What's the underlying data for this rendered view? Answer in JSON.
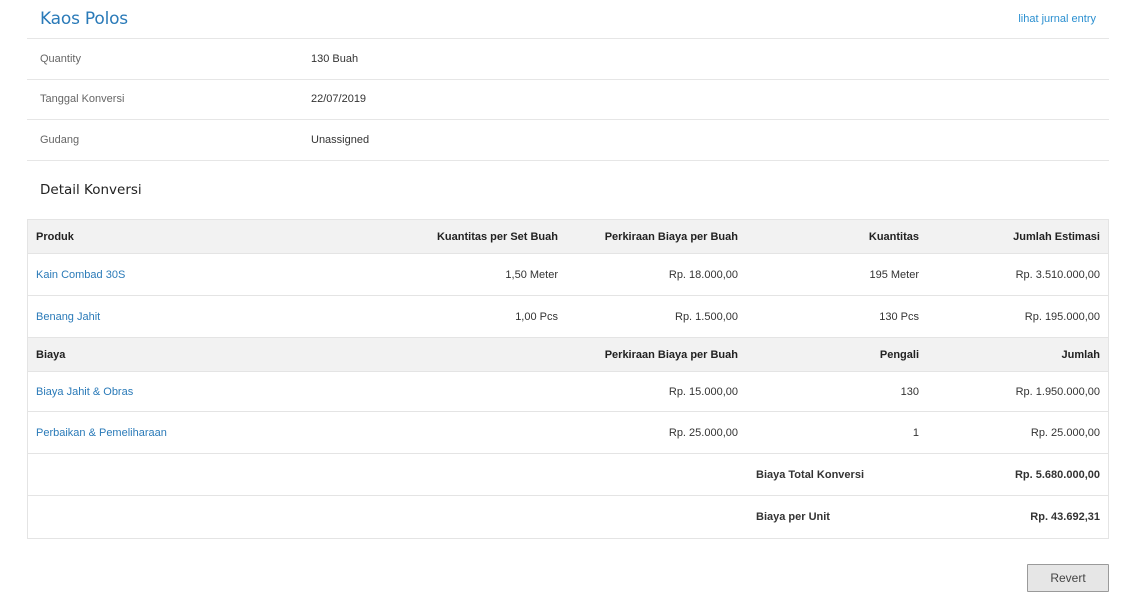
{
  "header": {
    "title": "Kaos Polos",
    "journal_link": "lihat jurnal entry"
  },
  "info": [
    {
      "label": "Quantity",
      "value": "130 Buah"
    },
    {
      "label": "Tanggal Konversi",
      "value": "22/07/2019"
    },
    {
      "label": "Gudang",
      "value": "Unassigned"
    }
  ],
  "detail": {
    "section_title": "Detail Konversi",
    "product_headers": [
      "Produk",
      "Kuantitas per Set Buah",
      "Perkiraan Biaya per Buah",
      "Kuantitas",
      "Jumlah Estimasi"
    ],
    "products": [
      {
        "name": "Kain Combad 30S",
        "qty_per_set": "1,50 Meter",
        "cost_per_unit": "Rp. 18.000,00",
        "qty": "195 Meter",
        "estimate": "Rp. 3.510.000,00"
      },
      {
        "name": "Benang Jahit",
        "qty_per_set": "1,00 Pcs",
        "cost_per_unit": "Rp. 1.500,00",
        "qty": "130 Pcs",
        "estimate": "Rp. 195.000,00"
      }
    ],
    "cost_headers": [
      "Biaya",
      "Perkiraan Biaya per Buah",
      "Pengali",
      "Jumlah"
    ],
    "costs": [
      {
        "name": "Biaya Jahit & Obras",
        "cost_per_unit": "Rp. 15.000,00",
        "multiplier": "130",
        "amount": "Rp. 1.950.000,00"
      },
      {
        "name": "Perbaikan & Pemeliharaan",
        "cost_per_unit": "Rp. 25.000,00",
        "multiplier": "1",
        "amount": "Rp. 25.000,00"
      }
    ],
    "totals": [
      {
        "label": "Biaya Total Konversi",
        "value": "Rp. 5.680.000,00"
      },
      {
        "label": "Biaya per Unit",
        "value": "Rp. 43.692,31"
      }
    ]
  },
  "actions": {
    "revert_label": "Revert"
  }
}
